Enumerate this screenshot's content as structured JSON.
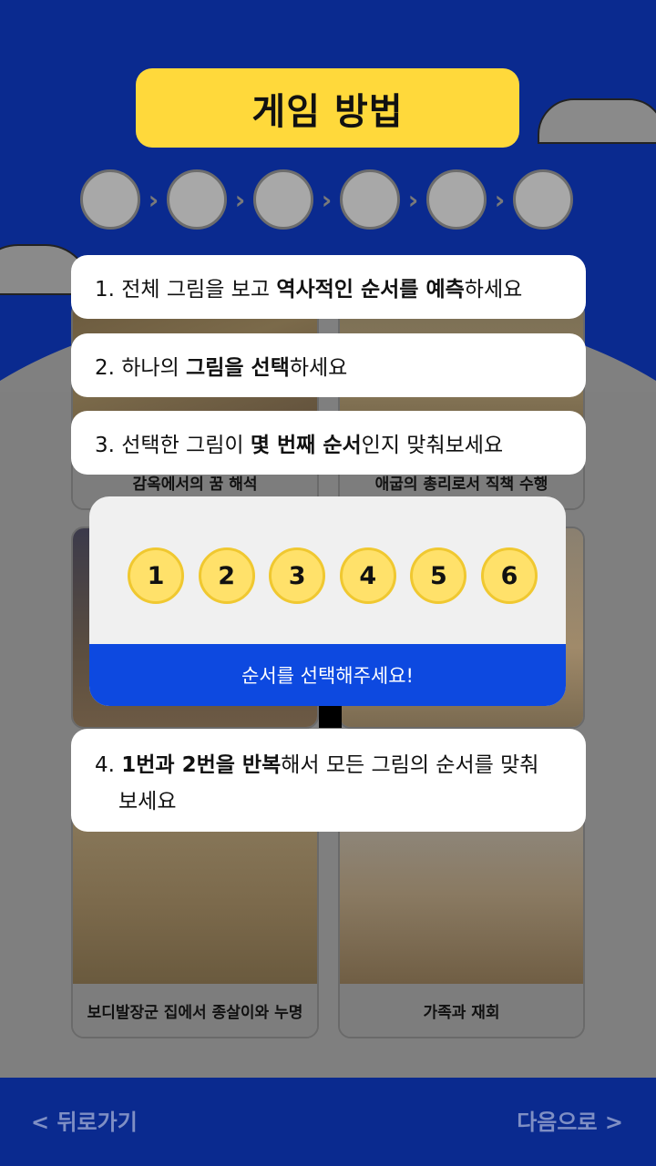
{
  "header": {
    "title": "게임 방법"
  },
  "steps": {
    "count": 6,
    "arrow": "›"
  },
  "cards": [
    {
      "caption": "감옥에서의 꿈 해석"
    },
    {
      "caption": "애굽의 총리로서 직책 수행"
    },
    {
      "caption": ""
    },
    {
      "caption": ""
    },
    {
      "caption": "보디발장군 집에서 종살이와 누명"
    },
    {
      "caption": "가족과 재회"
    }
  ],
  "instructions": {
    "i1": {
      "a": "1. 전체 그림을 보고 ",
      "b": "역사적인 순서를 예측",
      "c": "하세요"
    },
    "i2": {
      "a": "2. 하나의 ",
      "b": "그림을 선택",
      "c": "하세요"
    },
    "i3": {
      "a": "3. 선택한 그림이 ",
      "b": "몇 번째 순서",
      "c": "인지 맞춰보세요"
    },
    "i4": {
      "a": "4. ",
      "b": "1번과 2번을 반복",
      "c": "해서 모든 그림의 순서를 맞춰",
      "d": "보세요"
    }
  },
  "popup": {
    "numbers": [
      "1",
      "2",
      "3",
      "4",
      "5",
      "6"
    ],
    "prompt": "순서를 선택해주세요!"
  },
  "footer": {
    "back": "< 뒤로가기",
    "next": "다음으로 >"
  },
  "colors": {
    "primary": "#0a2a8f",
    "accent": "#ffd93b",
    "button_blue": "#0d49e0",
    "dim": "#7f7f7f"
  }
}
